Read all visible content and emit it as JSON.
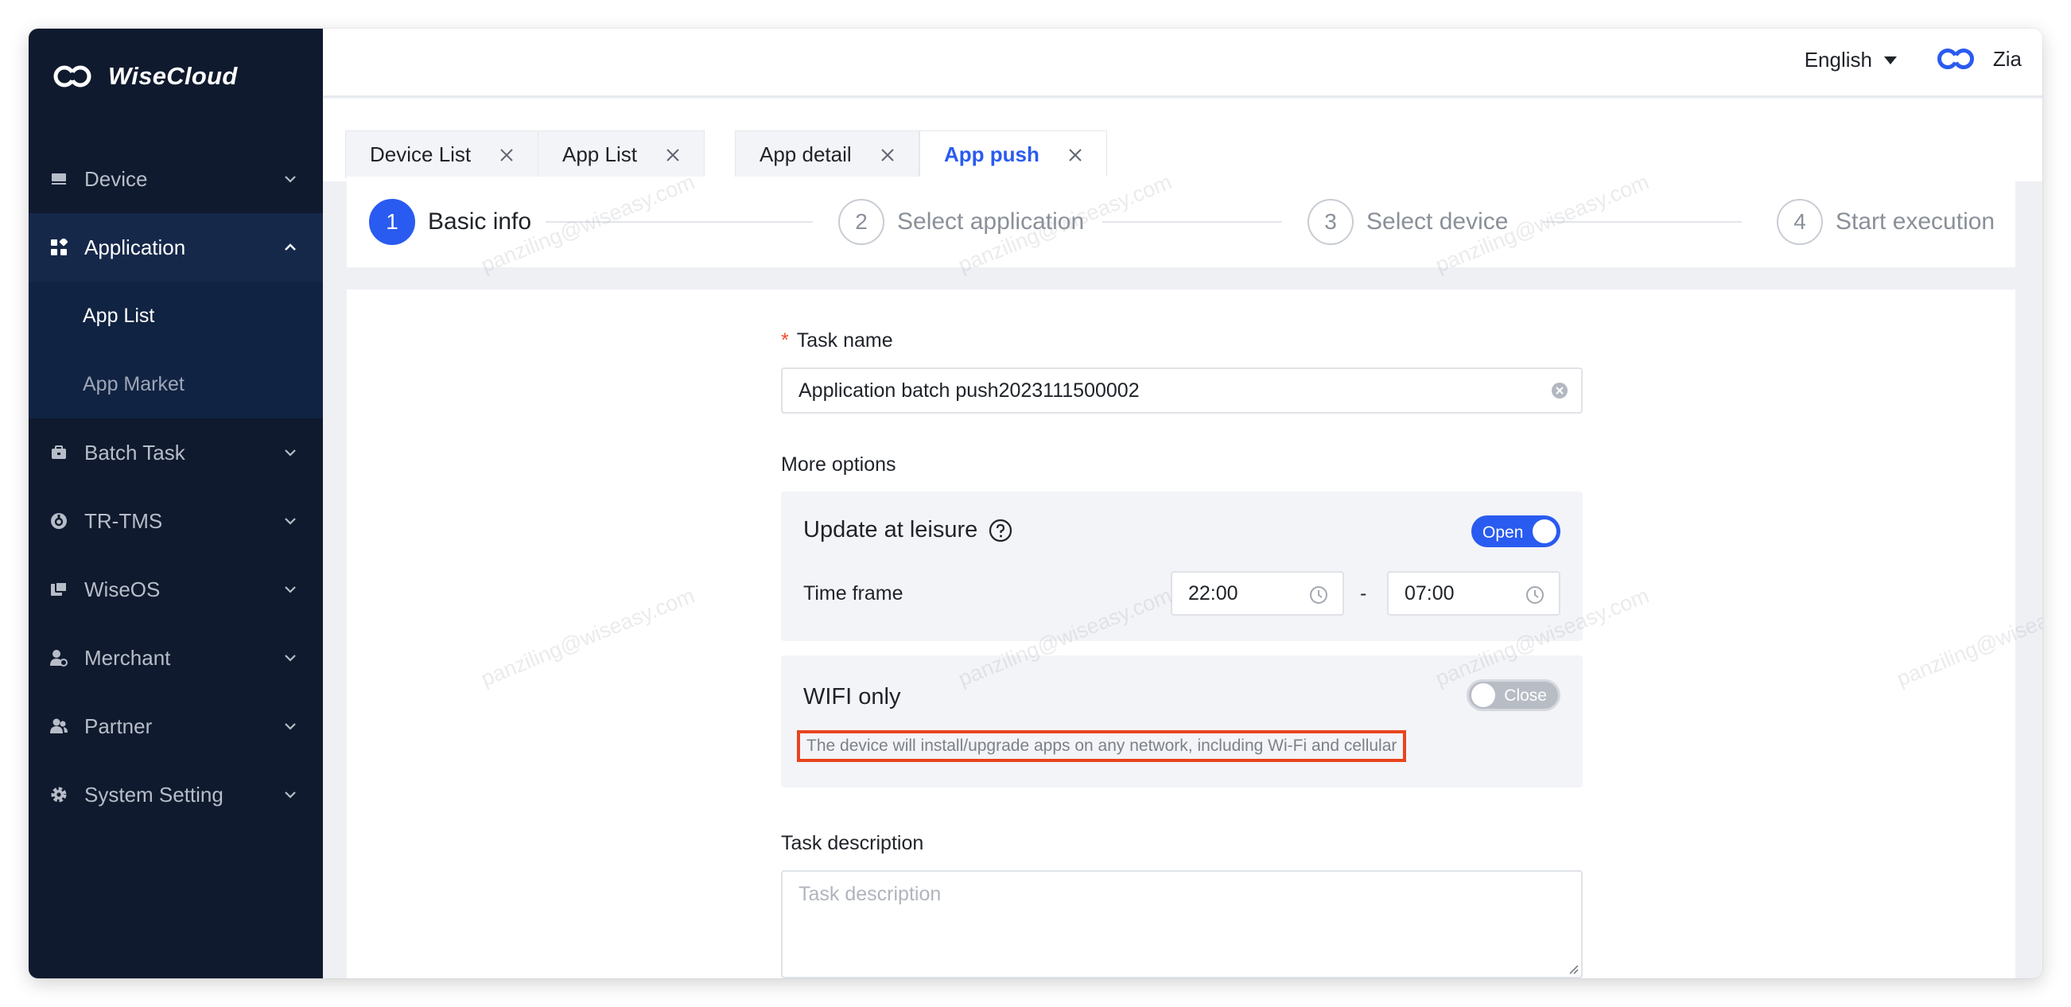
{
  "app": {
    "name": "WiseCloud"
  },
  "header": {
    "language": "English",
    "user_name": "Zia"
  },
  "sidebar": {
    "items": [
      {
        "label": "Device",
        "icon": "device-icon",
        "expanded": false
      },
      {
        "label": "Application",
        "icon": "application-icon",
        "expanded": true,
        "children": [
          {
            "label": "App List",
            "active": true
          },
          {
            "label": "App Market",
            "active": false
          }
        ]
      },
      {
        "label": "Batch Task",
        "icon": "batch-task-icon",
        "expanded": false
      },
      {
        "label": "TR-TMS",
        "icon": "tr-tms-icon",
        "expanded": false
      },
      {
        "label": "WiseOS",
        "icon": "wiseos-icon",
        "expanded": false
      },
      {
        "label": "Merchant",
        "icon": "merchant-icon",
        "expanded": false
      },
      {
        "label": "Partner",
        "icon": "partner-icon",
        "expanded": false
      },
      {
        "label": "System Setting",
        "icon": "gear-icon",
        "expanded": false
      }
    ]
  },
  "tabs": [
    {
      "label": "Device List",
      "active": false
    },
    {
      "label": "App List",
      "active": false
    },
    {
      "label": "App detail",
      "active": false
    },
    {
      "label": "App push",
      "active": true
    }
  ],
  "steps": [
    {
      "num": "1",
      "label": "Basic info",
      "active": true
    },
    {
      "num": "2",
      "label": "Select application",
      "active": false
    },
    {
      "num": "3",
      "label": "Select device",
      "active": false
    },
    {
      "num": "4",
      "label": "Start execution",
      "active": false
    }
  ],
  "form": {
    "task_name": {
      "label": "Task name",
      "required_mark": "*",
      "value": "Application batch push2023111500002"
    },
    "more_options_label": "More options",
    "update_at_leisure": {
      "title": "Update at leisure",
      "toggle_label": "Open",
      "toggle_state": "on",
      "time_frame_label": "Time frame",
      "start_time": "22:00",
      "separator": "-",
      "end_time": "07:00"
    },
    "wifi_only": {
      "title": "WIFI only",
      "toggle_label": "Close",
      "toggle_state": "off",
      "hint": "The device will install/upgrade apps on any network, including Wi-Fi and cellular"
    },
    "task_description": {
      "label": "Task description",
      "placeholder": "Task description",
      "value": ""
    }
  },
  "watermark": "panziling@wiseasy.com",
  "colors": {
    "accent": "#2a5bf0",
    "sidebar_bg": "#0f1a2e",
    "highlight_border": "#e8441f",
    "required": "#f04a2f"
  }
}
